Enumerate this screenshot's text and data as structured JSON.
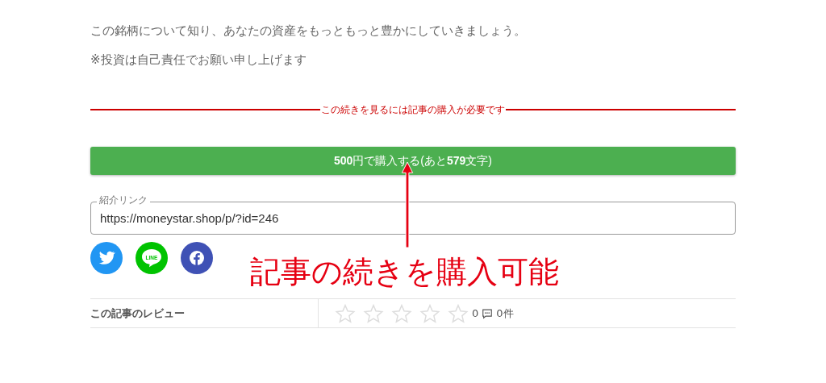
{
  "paragraphs": [
    "この銘柄について知り、あなたの資産をもっともっと豊かにしていきましょう。",
    "※投資は自己責任でお願い申し上げます"
  ],
  "paywall_notice": "この続きを見るには記事の購入が必要です",
  "buy_button": {
    "price": "500",
    "label": "円で購入する(あと",
    "count": "579",
    "suffix": "文字)"
  },
  "referral": {
    "label": "紹介リンク",
    "value": "https://moneystar.shop/p/?id=246"
  },
  "share_line_label": "LINE",
  "review": {
    "label": "この記事のレビュー",
    "stars": 0,
    "rating": "0",
    "comments": "0件"
  },
  "annotation": "記事の続きを購入可能"
}
